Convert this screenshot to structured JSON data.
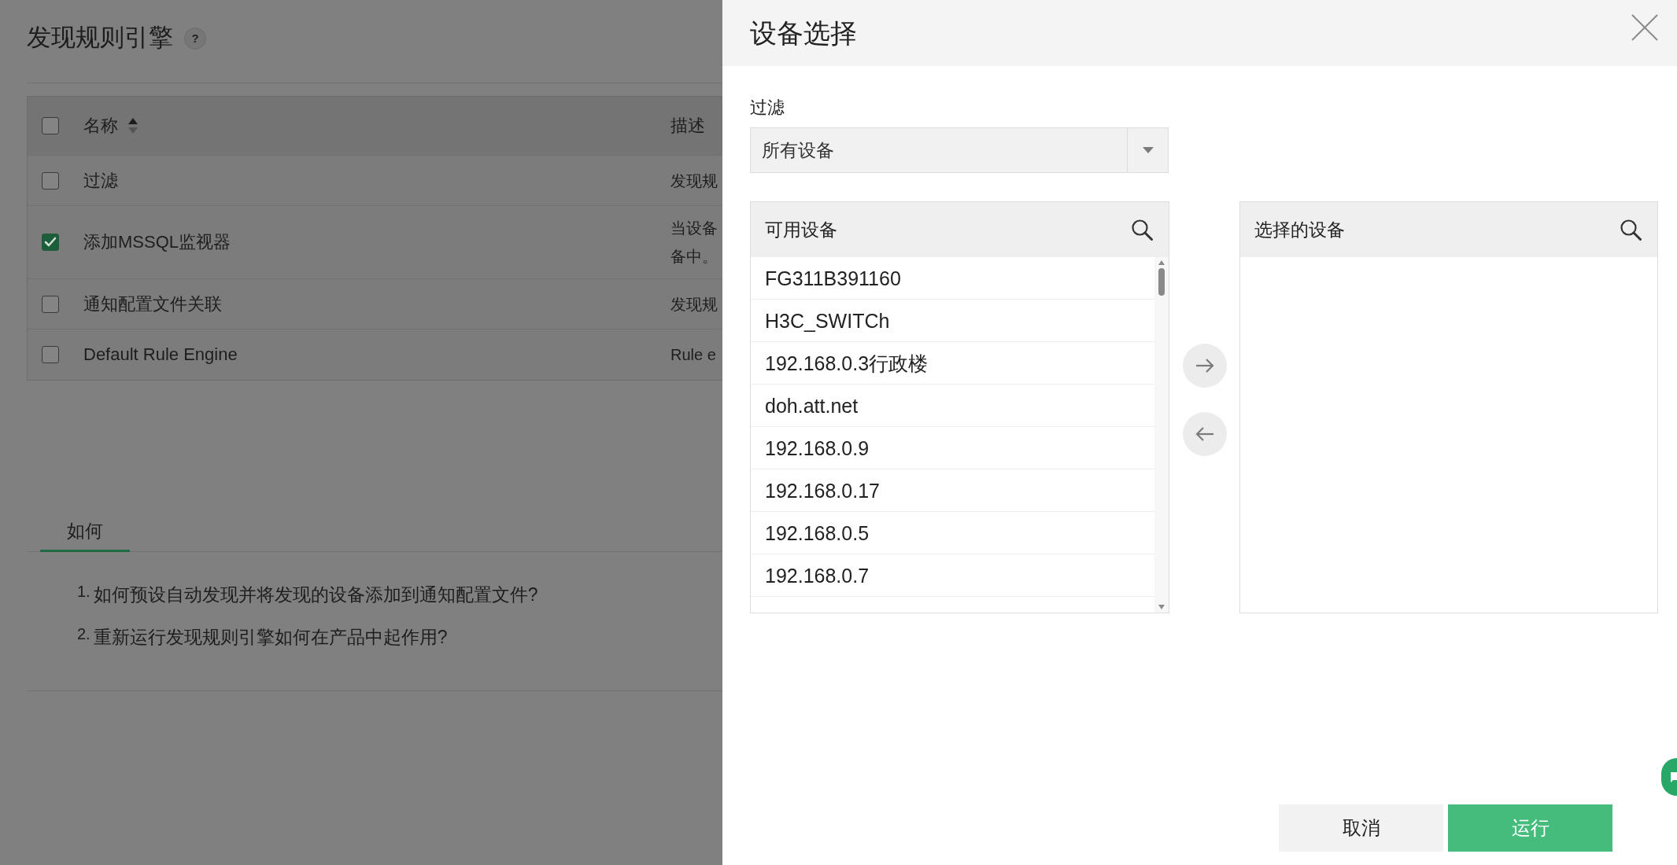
{
  "page": {
    "title": "发现规则引擎",
    "help": "?",
    "table": {
      "header_checked": false,
      "columns": [
        {
          "label": "名称",
          "sortable": true
        },
        {
          "label": "描述"
        }
      ],
      "rows": [
        {
          "checked": false,
          "name": "过滤",
          "description": "发现规"
        },
        {
          "checked": true,
          "name": "添加MSSQL监视器",
          "description": "当设备备中。"
        },
        {
          "checked": false,
          "name": "通知配置文件关联",
          "description": "发现规"
        },
        {
          "checked": false,
          "name": "Default Rule Engine",
          "description": "Rule e"
        }
      ]
    },
    "howto": {
      "tabs": [
        {
          "label": "如何",
          "selected": true
        }
      ],
      "items": [
        {
          "number": "1.",
          "text": "如何预设自动发现并将发现的设备添加到通知配置文件?"
        },
        {
          "number": "2.",
          "text": "重新运行发现规则引擎如何在产品中起作用?"
        }
      ]
    }
  },
  "dialog": {
    "title": "设备选择",
    "filter": {
      "label": "过滤",
      "value": "所有设备"
    },
    "available": {
      "title": "可用设备",
      "items": [
        {
          "label": "FG311B391160",
          "selected": false
        },
        {
          "label": "H3C_SWITCh",
          "selected": false
        },
        {
          "label": "192.168.0.3行政楼",
          "selected": false
        },
        {
          "label": "doh.att.net",
          "selected": false
        },
        {
          "label": "192.168.0.9",
          "selected": false
        },
        {
          "label": "192.168.0.17",
          "selected": false
        },
        {
          "label": "192.168.0.5",
          "selected": false
        },
        {
          "label": "192.168.0.7",
          "selected": false
        }
      ]
    },
    "chosen": {
      "title": "选择的设备"
    },
    "buttons": [
      {
        "label": "取消",
        "kind": "secondary"
      },
      {
        "label": "运行",
        "kind": "primary"
      }
    ]
  }
}
